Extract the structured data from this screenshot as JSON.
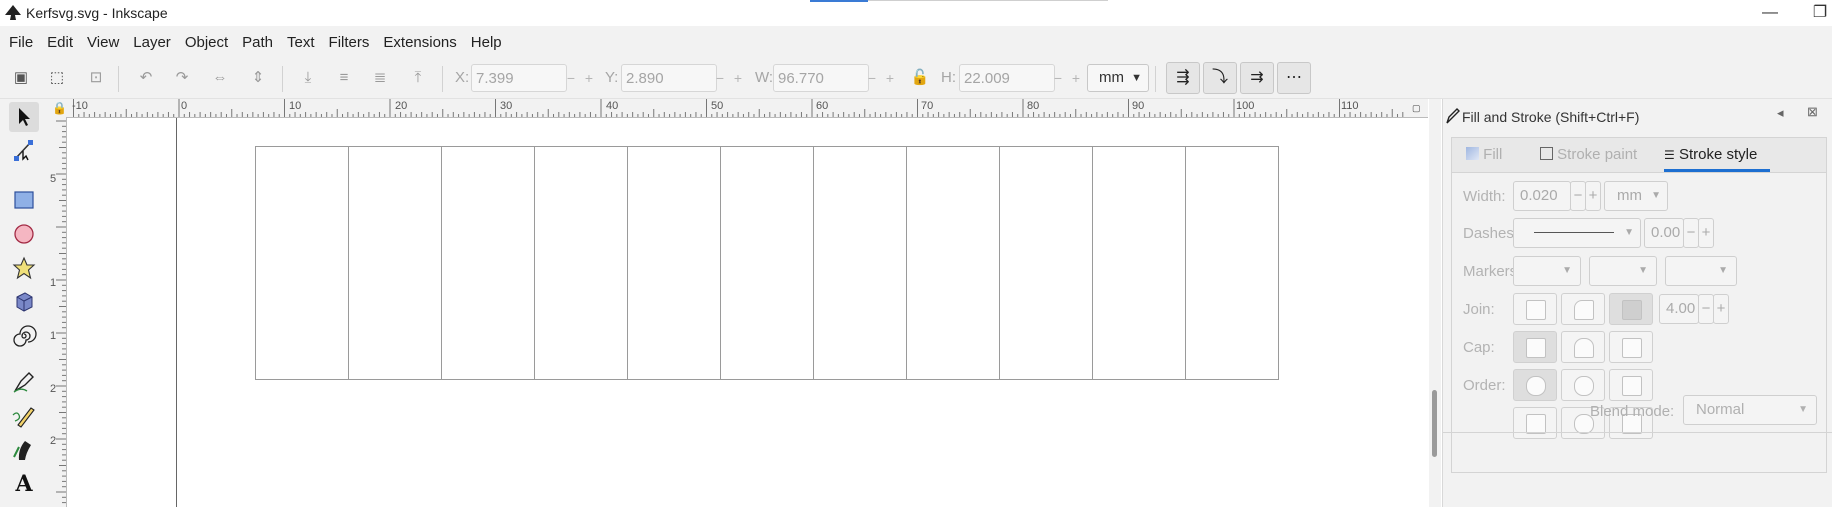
{
  "window": {
    "title": "Kerfsvg.svg - Inkscape",
    "minimize": "—",
    "maximize": "❐"
  },
  "menu": [
    "File",
    "Edit",
    "View",
    "Layer",
    "Object",
    "Path",
    "Text",
    "Filters",
    "Extensions",
    "Help"
  ],
  "toolbar": {
    "x_label": "X:",
    "x_value": "7.399",
    "y_label": "Y:",
    "y_value": "2.890",
    "w_label": "W:",
    "w_value": "96.770",
    "h_label": "H:",
    "h_value": "22.009",
    "unit": "mm",
    "spin_minus": "−",
    "spin_plus": "+"
  },
  "ruler": {
    "h_labels": [
      "-10",
      "0",
      "10",
      "20",
      "30",
      "40",
      "50",
      "60",
      "70",
      "80",
      "90",
      "100",
      "110"
    ],
    "v_labels": [
      "5",
      "1",
      "1",
      "2",
      "2"
    ]
  },
  "drawing": {
    "columns": 11,
    "stroke": "#9a9a9a"
  },
  "dock": {
    "title": "Fill and Stroke (Shift+Ctrl+F)",
    "tabs": [
      {
        "label": "Fill",
        "icon": "fill-flat-icon",
        "active": false
      },
      {
        "label": "Stroke paint",
        "icon": "stroke-paint-icon",
        "active": false
      },
      {
        "label": "Stroke style",
        "icon": "stroke-style-icon",
        "active": true
      }
    ],
    "width_label": "Width:",
    "width_value": "0.020",
    "width_unit": "mm",
    "dashes_label": "Dashes:",
    "dash_offset": "0.00",
    "markers_label": "Markers:",
    "join_label": "Join:",
    "miter_limit": "4.00",
    "cap_label": "Cap:",
    "order_label": "Order:",
    "blend_label": "Blend mode:",
    "blend_value": "Normal"
  },
  "colors": {
    "accent": "#1d6fd1",
    "panel_bg": "#f2f2f2",
    "canvas_bg": "#ffffff"
  }
}
